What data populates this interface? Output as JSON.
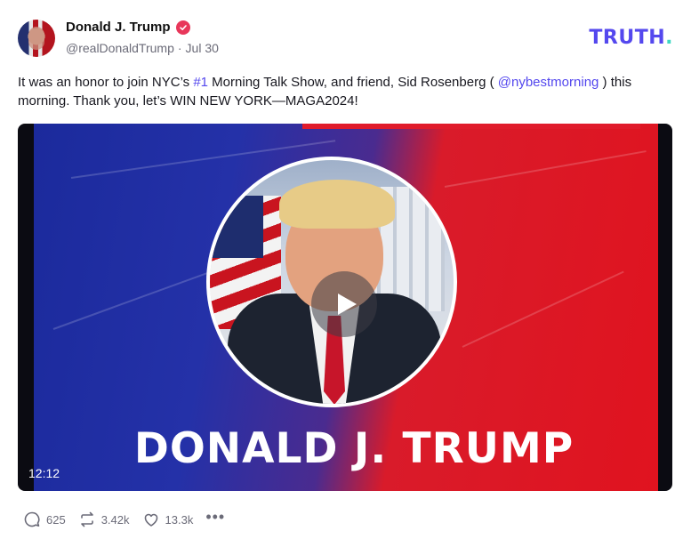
{
  "author": {
    "name": "Donald J. Trump",
    "handle": "@realDonaldTrump",
    "separator": "·",
    "date": "Jul 30",
    "verified_icon": "verified-badge-icon"
  },
  "brand": {
    "logo_text": "TRUTH",
    "logo_dot": ".",
    "logo_color": "#5448ee",
    "dot_color": "#3fd8c2"
  },
  "post": {
    "text_1": "It was an honor to join NYC’s ",
    "hashtag": "#1",
    "text_2": " Morning Talk Show, and friend, Sid Rosenberg ( ",
    "mention": "@nybestmorning",
    "text_3": " ) this morning. Thank you, let’s WIN NEW YORK—MAGA2024!"
  },
  "video": {
    "caption": "DONALD J. TRUMP",
    "duration": "12:12",
    "play_icon": "play-icon"
  },
  "actions": {
    "replies": "625",
    "reposts": "3.42k",
    "likes": "13.3k",
    "more": "•••"
  },
  "colors": {
    "accent": "#5448ee",
    "verified": "#e8375a"
  }
}
